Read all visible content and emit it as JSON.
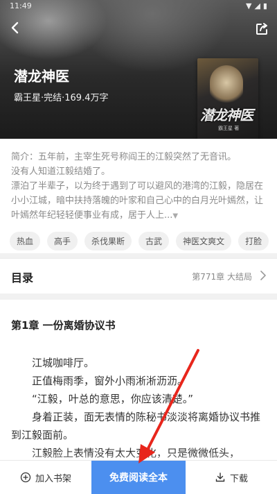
{
  "status": {
    "time": "11:49",
    "icons": "▼◢▮"
  },
  "book": {
    "title": "潜龙神医",
    "meta": "霸王星·完结·169.4万字",
    "cover_title": "潜龙神医",
    "cover_author": "霸王星 著"
  },
  "intro": {
    "line1": "简介：五年前，主宰生死号称阎王的江毅突然了无音讯。",
    "line2": "没有人知道江毅结婚了。",
    "line3": "漂泊了半辈子，以为终于遇到了可以避风的港湾的江毅，隐居在小小江城，暗中扶持落魄的叶家和自己心中的白月光叶嫣然，让叶嫣然年纪轻轻便事业有成，居于人上...",
    "more": "▼"
  },
  "tags": [
    "热血",
    "高手",
    "杀伐果断",
    "古武",
    "神医文爽文",
    "打脸"
  ],
  "toc": {
    "label": "目录",
    "latest": "第771章 大结局"
  },
  "reader": {
    "chapter_title": "第1章 一份离婚协议书",
    "paragraphs": [
      "江城咖啡厅。",
      "正值梅雨季，窗外小雨淅淅沥沥。",
      "“江毅，叶总的意思，你应该清楚。”",
      "身着正装，面无表情的陈秘书淡淡将离婚协议书推到江毅面前。",
      "江毅脸上表情没有太大变化，只是微微低头，"
    ]
  },
  "bottom": {
    "shelf_label": "加入书架",
    "read_label": "免费阅读全本",
    "download_label": "下载"
  },
  "colors": {
    "accent": "#4c8fef",
    "annotation": "#e8261c"
  }
}
